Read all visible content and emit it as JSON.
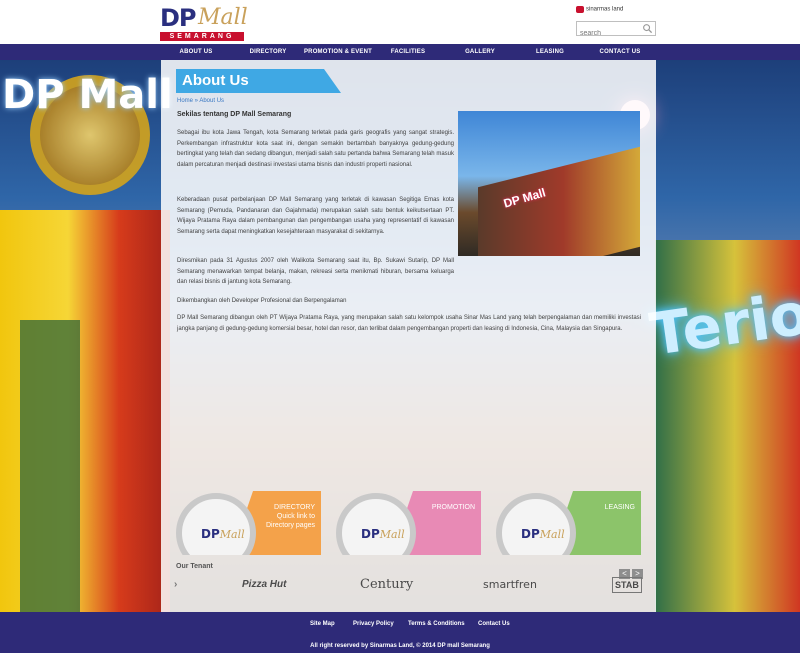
{
  "header": {
    "logo_dp": "DP",
    "logo_mall": "Mall",
    "logo_city": "SEMARANG",
    "partner_logo": "sinarmas land",
    "search_placeholder": "search"
  },
  "nav": {
    "items": [
      "ABOUT US",
      "DIRECTORY",
      "PROMOTION & EVENT",
      "FACILITIES",
      "GALLERY",
      "LEASING",
      "CONTACT US"
    ]
  },
  "page": {
    "title": "About Us",
    "breadcrumb": "Home » About Us",
    "section_heading": "Sekilas tentang DP Mall Semarang",
    "paragraphs": [
      "Sebagai ibu kota Jawa Tengah, kota Semarang terletak pada garis geografis yang sangat strategis. Perkembangan infrastruktur kota saat ini, dengan semakin bertambah banyaknya gedung-gedung bertingkat yang telah dan sedang dibangun, menjadi salah satu pertanda bahwa Semarang telah masuk dalam percaturan menjadi destinasi investasi utama bisnis dan industri properti nasional.",
      "Keberadaan pusat perbelanjaan DP Mall Semarang yang terletak di kawasan Segitiga Emas kota Semarang (Pemuda, Pandanaran dan Gajahmada) merupakan salah satu bentuk keikutsertaan PT. Wijaya Pratama Raya dalam pembangunan dan pengembangan usaha yang representatif di kawasan Semarang serta dapat meningkatkan kesejahteraan masyarakat di sekitarnya.",
      "Diresmikan pada 31 Agustus 2007 oleh Walikota Semarang saat itu, Bp. Sukawi Sutarip, DP Mall Semarang menawarkan tempat belanja, makan, rekreasi serta menikmati hiburan, bersama keluarga dan relasi bisnis di jantung kota Semarang.",
      "Dikembangkan oleh Developer Profesional dan Berpengalaman",
      "DP Mall Semarang dibangun oleh PT Wijaya Pratama Raya, yang merupakan salah satu kelompok usaha Sinar Mas Land yang telah berpengalaman dan memiliki investasi jangka panjang di gedung-gedung komersial besar, hotel dan resor, dan terlibat dalam pengembangan properti dan leasing di Indonesia, Cina, Malaysia dan Singapura."
    ],
    "photo_sign": "DP Mall"
  },
  "features": [
    {
      "label": "DIRECTORY",
      "sub": "Quick link to Directory pages",
      "color": "#f4a24a"
    },
    {
      "label": "PROMOTION",
      "sub": "",
      "color": "#e88ab5"
    },
    {
      "label": "LEASING",
      "sub": "",
      "color": "#8cc46a"
    }
  ],
  "tenants": {
    "heading": "Our Tenant",
    "prev": "<",
    "next": ">",
    "logos": [
      "›",
      "Pizza Hut",
      "Century",
      "smartfren",
      "STAB"
    ]
  },
  "footer": {
    "links": [
      "Site Map",
      "Privacy Policy",
      "Terms & Conditions",
      "Contact Us"
    ],
    "copyright": "All right reserved by Sinarmas Land, © 2014 DP mall Semarang"
  },
  "background": {
    "sign_left": "DP Mall",
    "sign_right": "Terio"
  },
  "colors": {
    "nav": "#2e2a78",
    "title_banner": "#3fa8e4",
    "brand_red": "#c8102e"
  }
}
